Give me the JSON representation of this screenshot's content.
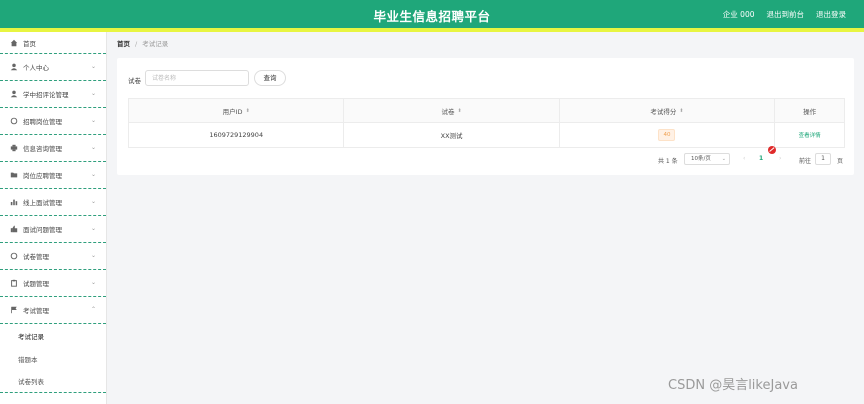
{
  "header": {
    "title": "毕业生信息招聘平台",
    "user": "企业 000",
    "back_to_front": "退出到前台",
    "logout": "退出登录"
  },
  "sidebar": {
    "home": "首页",
    "items": [
      {
        "label": "个人中心",
        "icon": "user-icon"
      },
      {
        "label": "学中招评论管理",
        "icon": "user-group-icon"
      },
      {
        "label": "招聘岗位管理",
        "icon": "refresh-icon"
      },
      {
        "label": "信息咨询管理",
        "icon": "printer-icon"
      },
      {
        "label": "岗位应聘管理",
        "icon": "folder-icon"
      },
      {
        "label": "线上面试管理",
        "icon": "bar-chart-icon"
      },
      {
        "label": "面试问题管理",
        "icon": "thumb-icon"
      },
      {
        "label": "试卷管理",
        "icon": "circle-icon"
      },
      {
        "label": "试题管理",
        "icon": "clipboard-icon"
      },
      {
        "label": "考试管理",
        "icon": "flag-icon"
      }
    ],
    "subitems": [
      "考试记录",
      "错题本",
      "试卷列表"
    ]
  },
  "breadcrumb": {
    "home": "首页",
    "separator": "/",
    "current": "考试记录"
  },
  "search": {
    "label": "试卷",
    "placeholder": "试卷名称",
    "button": "查询"
  },
  "table": {
    "columns": [
      "用户ID",
      "试卷",
      "考试得分",
      "操作"
    ],
    "rows": [
      {
        "user_id": "1609729129904",
        "paper": "XX测试",
        "score": "40",
        "action": "查看详情"
      }
    ]
  },
  "pagination": {
    "total": "共 1 条",
    "page_size": "10条/页",
    "prev": "‹",
    "current_page": "1",
    "next": "›",
    "goto_label": "前往",
    "goto_value": "1",
    "unit": "页"
  },
  "watermark": "CSDN @昊言likeJava",
  "colors": {
    "primary": "#1fa77a",
    "accent_line": "#e8f541",
    "badge_text": "#f0a050"
  }
}
